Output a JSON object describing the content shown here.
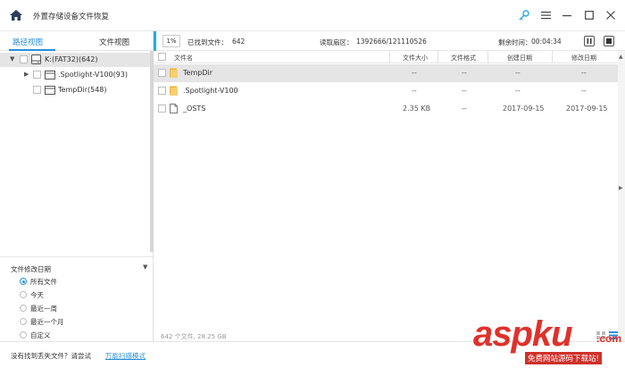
{
  "window": {
    "title": "外置存储设备文件恢复"
  },
  "left_panel": {
    "tabs": [
      {
        "label": "路径视图",
        "active": true
      },
      {
        "label": "文件视图",
        "active": false
      }
    ],
    "tree": [
      {
        "label": "K:(FAT32)(642)",
        "expanded": true,
        "icon": "drive-icon"
      },
      {
        "label": ".Spotlight-V100(93)",
        "expanded": false,
        "icon": "folder-outline-icon"
      },
      {
        "label": "TempDir(548)",
        "expanded": false,
        "icon": "folder-outline-icon"
      }
    ],
    "filter": {
      "title": "文件修改日期",
      "options": [
        {
          "label": "所有文件",
          "selected": true
        },
        {
          "label": "今天",
          "selected": false
        },
        {
          "label": "最近一周",
          "selected": false
        },
        {
          "label": "最近一个月",
          "selected": false
        },
        {
          "label": "自定义",
          "selected": false
        }
      ]
    }
  },
  "status": {
    "percent": "1%",
    "found_label": "已找到文件：",
    "found_value": "642",
    "read_label": "读取扇区：",
    "read_value": "1392666/121110526",
    "remaining_label": "剩余时间：",
    "remaining_value": "00:04:34"
  },
  "table": {
    "columns": [
      "文件名",
      "文件大小",
      "文件格式",
      "创建日期",
      "修改日期"
    ],
    "rows": [
      {
        "name": "TempDir",
        "size": "--",
        "format": "--",
        "created": "--",
        "modified": "--",
        "icon": "folder-icon"
      },
      {
        "name": ".Spotlight-V100",
        "size": "--",
        "format": "--",
        "created": "--",
        "modified": "--",
        "icon": "folder-icon"
      },
      {
        "name": "_OSTS",
        "size": "2.35 KB",
        "format": "--",
        "created": "2017-09-15",
        "modified": "2017-09-15",
        "icon": "file-icon"
      }
    ]
  },
  "summary": "642 个文件, 28.25 GB",
  "bottom": {
    "hint": "没有找到丢失文件？请尝试",
    "link": "万能扫描模式"
  },
  "watermark": {
    "main": "aspku",
    "suffix": ".com",
    "sub": "免费网站源码下载站!"
  },
  "colors": {
    "accent": "#2a8fd8",
    "folder": "#f2c04b",
    "watermark": "#e0312b"
  }
}
